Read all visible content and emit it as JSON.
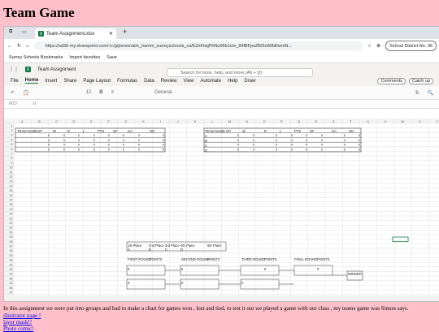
{
  "page": {
    "title": "Team Game",
    "description": "In this assignment we were put into groups and had to make a chart for games won , lost and tied, to test it out we played a game with our class , my teams game was Simon says.",
    "links": [
      "illustrator page !",
      "layer mask!!",
      "Photo comic!"
    ]
  },
  "browser": {
    "tab_title": "Team Assignment.xlsx",
    "url": "https://sd36-my.sharepoint.com/:x:/g/personal/e_hamm_surreyschools_ca/EZxFtwjPhNu06b1um_84fBFpsZB/5cfWbRwmN...",
    "profile": "School District No. 36",
    "bookmarks": [
      "Surrey Schools Bookmarks",
      "Import favorites",
      "Save"
    ]
  },
  "excel": {
    "doc_name": "Team Assignment",
    "search_placeholder": "Search for tools, help, and more (Alt + Q)",
    "menu": [
      "File",
      "Home",
      "Insert",
      "Share",
      "Page Layout",
      "Formulas",
      "Data",
      "Review",
      "View",
      "Automate",
      "Help",
      "Draw"
    ],
    "active_menu": "Home",
    "comments": "Comments",
    "catchup": "Catch up",
    "font_size": "12",
    "number_format": "General",
    "cell_ref": "M19",
    "left_table_headers": [
      "TEAM NAME",
      "GP",
      "W",
      "D",
      "L",
      "PTS",
      "GF",
      "GA",
      "GD"
    ],
    "right_table_headers": [
      "TEAM NAME",
      "GP",
      "W",
      "D",
      "L",
      "PTS",
      "GF",
      "GA",
      "GD"
    ],
    "right_team_letters": [
      "A",
      "B",
      "C",
      "D"
    ],
    "places": [
      "1st Place",
      "2nd Place",
      "3rd Place",
      "4th Place",
      "5th Place"
    ],
    "place_letters": [
      "A",
      "B",
      "C",
      "D"
    ],
    "rounds": [
      "FIRST ROUND",
      "POINTS",
      "SECOND ROUND",
      "POINTS",
      "THIRD ROUND",
      "POINTS",
      "FINAL ROUND",
      "POINTS"
    ],
    "bracket_scores": [
      "0",
      "0",
      "0",
      "0",
      "0",
      "0",
      "0"
    ],
    "winner": "WINNER",
    "zero": "0",
    "col_letters": [
      "A",
      "B",
      "C",
      "D",
      "E",
      "F",
      "G",
      "H",
      "I",
      "J",
      "K",
      "L",
      "M",
      "N",
      "O",
      "P",
      "Q",
      "R",
      "S",
      "T",
      "U",
      "V",
      "W",
      "X",
      "Y"
    ],
    "row_start": 1,
    "row_end": 38
  }
}
